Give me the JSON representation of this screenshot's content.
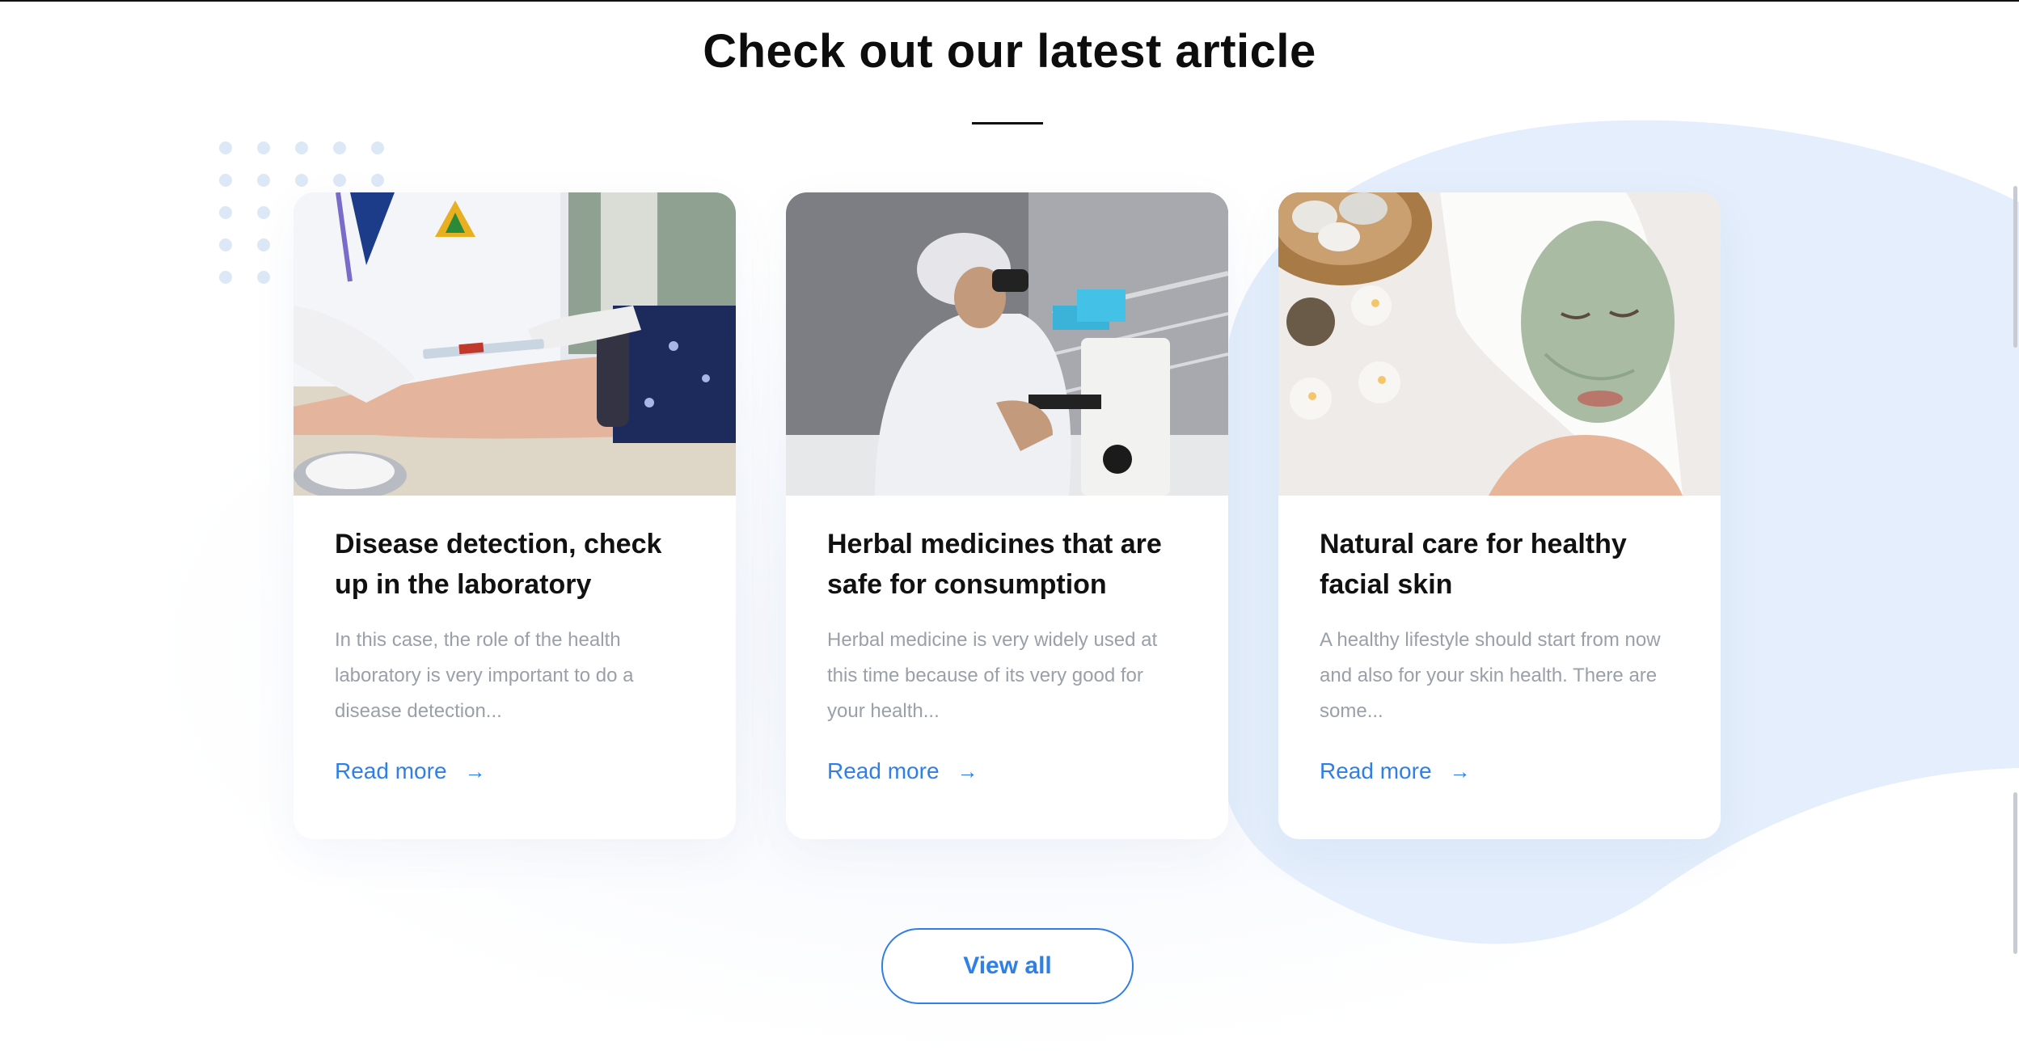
{
  "section": {
    "title": "Check out our latest article",
    "view_all_label": "View all"
  },
  "articles": [
    {
      "title": "Disease detection, check up in the laboratory",
      "description": "In this case, the role of the health laboratory is very important to do a disease detection...",
      "read_more": "Read more",
      "image_icon": "blood-test-photo"
    },
    {
      "title": "Herbal medicines that are safe for consumption",
      "description": "Herbal medicine is very widely used at this time because of its very good for your health...",
      "read_more": "Read more",
      "image_icon": "microscope-lab-photo"
    },
    {
      "title": "Natural care for healthy facial skin",
      "description": "A healthy lifestyle should start from now and also for your skin health. There are some...",
      "read_more": "Read more",
      "image_icon": "facial-mask-spa-photo"
    }
  ],
  "icons": {
    "arrow": "→"
  },
  "colors": {
    "accent": "#2f7fe6",
    "blob": "#e4eefc",
    "dots": "#dde8f7"
  }
}
